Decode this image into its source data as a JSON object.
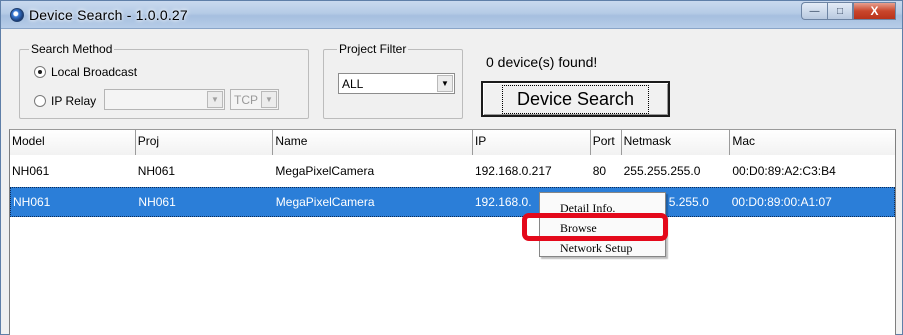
{
  "window": {
    "title": "Device Search - 1.0.0.27",
    "controls": {
      "minimize": "—",
      "maximize": "□",
      "close": "X"
    }
  },
  "search_method": {
    "legend": "Search Method",
    "options": [
      {
        "label": "Local Broadcast",
        "checked": true
      },
      {
        "label": "IP Relay",
        "checked": false
      }
    ],
    "ip_relay_value": "",
    "protocol_value": "TCP"
  },
  "project_filter": {
    "legend": "Project Filter",
    "value": "ALL"
  },
  "status": {
    "found_text": "0 device(s) found!"
  },
  "device_search_button": {
    "label": "Device Search"
  },
  "table": {
    "columns": [
      "Model",
      "Proj",
      "Name",
      "IP",
      "Port",
      "Netmask",
      "Mac"
    ],
    "rows": [
      [
        "NH061",
        "NH061",
        "MegaPixelCamera",
        "192.168.0.217",
        "80",
        "255.255.255.0",
        "00:D0:89:A2:C3:B4"
      ],
      [
        "NH061",
        "NH061",
        "MegaPixelCamera",
        "192.168.0.",
        "",
        "5.255.0",
        "00:D0:89:00:A1:07"
      ]
    ],
    "selected_row": 1
  },
  "context_menu": {
    "items": [
      "Detail Info.",
      "Browse",
      "Network Setup"
    ],
    "highlighted": "Browse"
  },
  "colors": {
    "selection": "#2b7ed8",
    "highlight_box": "#e4091b"
  }
}
